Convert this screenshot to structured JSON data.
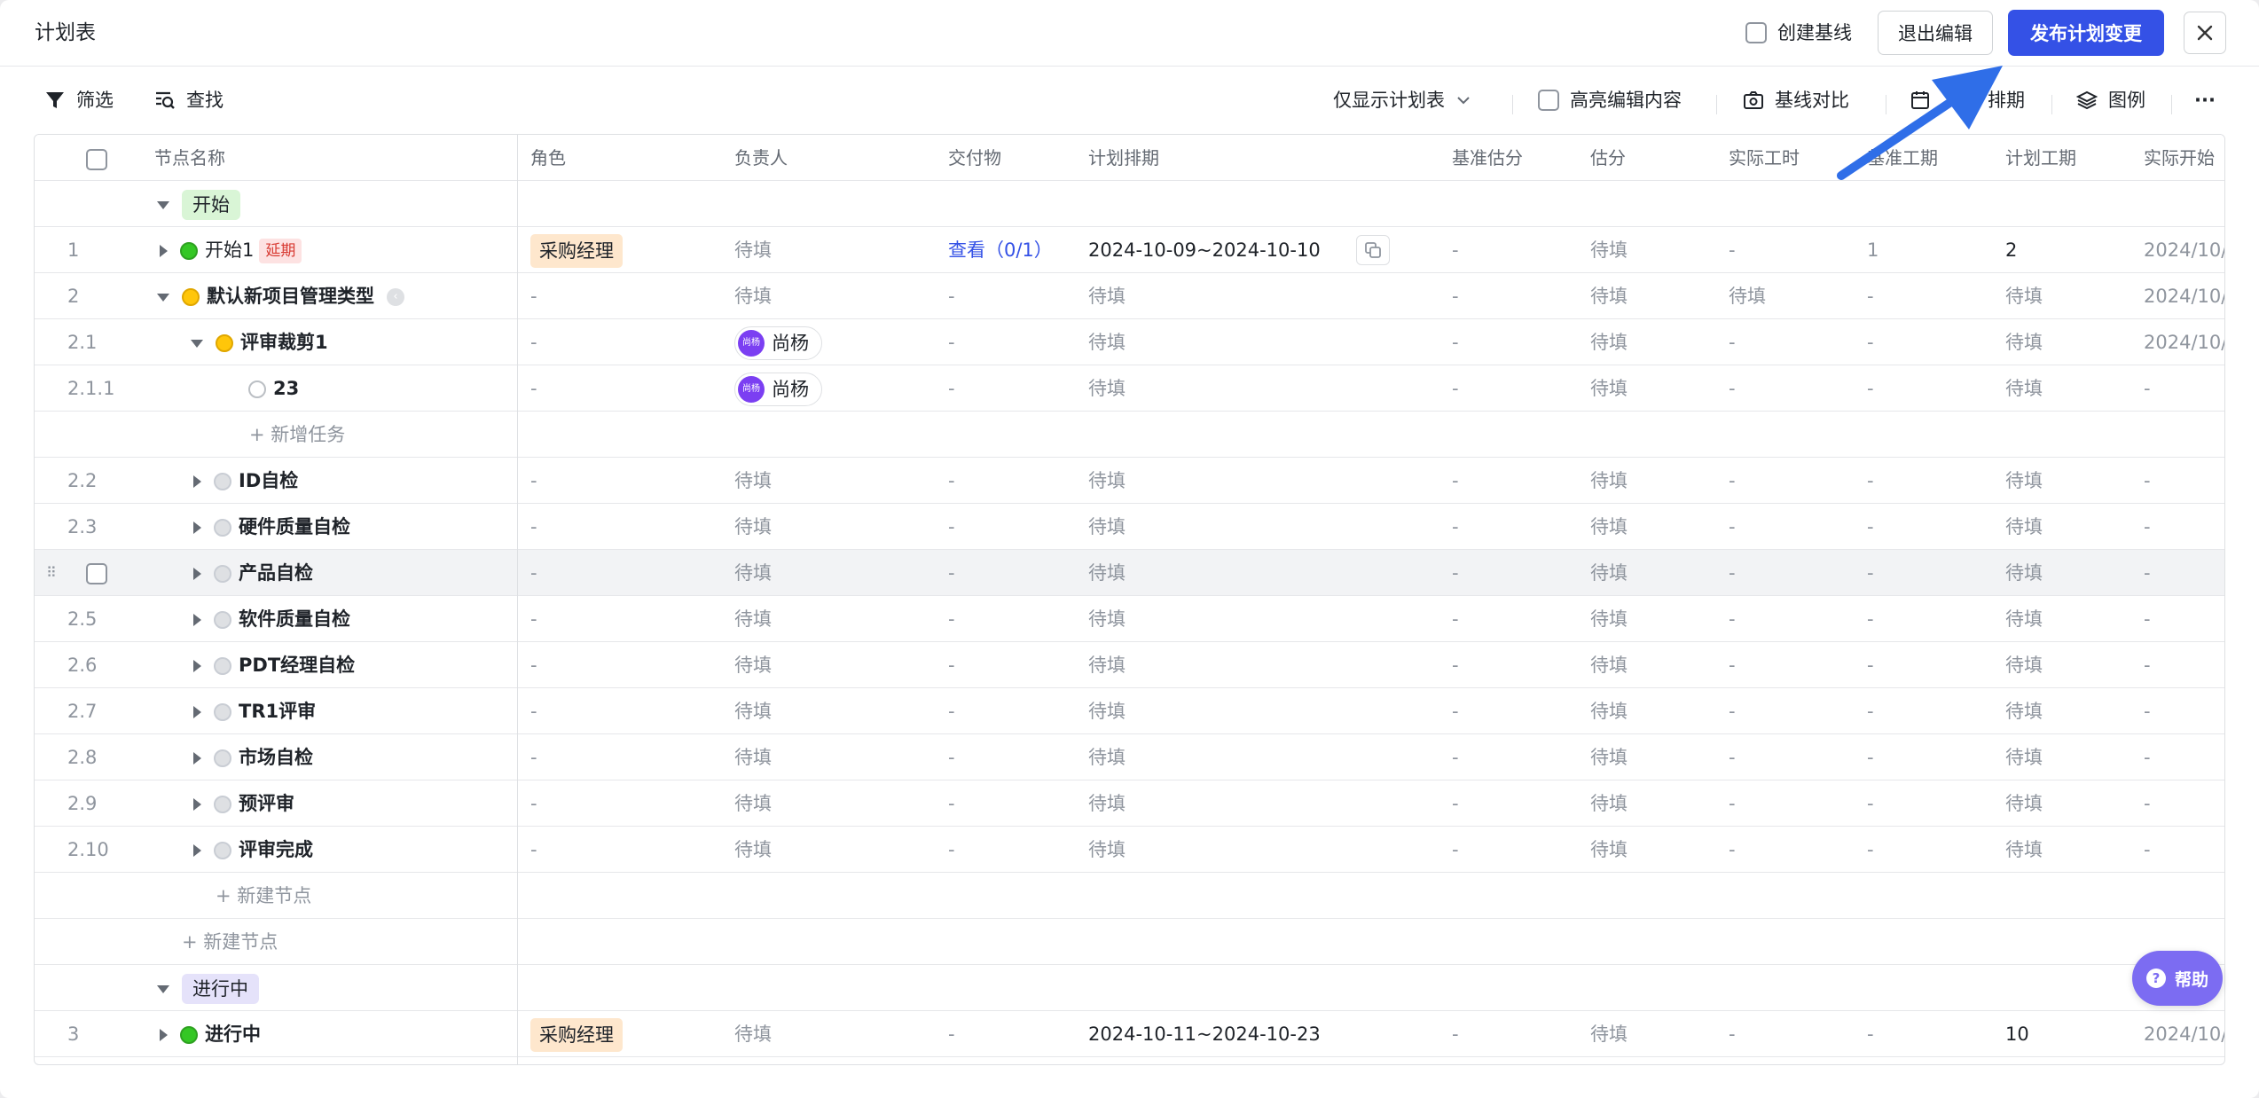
{
  "header": {
    "title": "计划表",
    "create_baseline_label": "创建基线",
    "exit_edit_label": "退出编辑",
    "publish_label": "发布计划变更"
  },
  "toolbar": {
    "filter_label": "筛选",
    "search_label": "查找",
    "view_select_label": "仅显示计划表",
    "highlight_label": "高亮编辑内容",
    "baseline_compare_label": "基线对比",
    "schedule_label": "排期",
    "legend_label": "图例",
    "more_label": "···"
  },
  "columns": {
    "name": "节点名称",
    "role": "角色",
    "owner": "负责人",
    "deliverable": "交付物",
    "plan_schedule": "计划排期",
    "baseline_estimate": "基准估分",
    "estimate": "估分",
    "actual_hours": "实际工时",
    "baseline_duration": "基准工期",
    "plan_duration": "计划工期",
    "actual_start": "实际开始"
  },
  "groups": {
    "start": "开始",
    "in_progress": "进行中"
  },
  "rows": {
    "r1": {
      "no": "1",
      "name": "开始1",
      "tag": "延期",
      "role": "采购经理",
      "owner": "待填",
      "deliverable": "查看（0/1）",
      "schedule": "2024-10-09~2024-10-10",
      "base_est": "-",
      "est": "待填",
      "actual": "-",
      "base_dur": "1",
      "plan_dur": "2",
      "start": "2024/10/"
    },
    "r2": {
      "no": "2",
      "name": "默认新项目管理类型",
      "role": "-",
      "owner": "待填",
      "deliverable": "-",
      "schedule": "待填",
      "base_est": "-",
      "est": "待填",
      "actual": "待填",
      "base_dur": "-",
      "plan_dur": "待填",
      "start": "2024/10/"
    },
    "r21": {
      "no": "2.1",
      "name": "评审裁剪1",
      "role": "-",
      "owner_name": "尚杨",
      "owner_avatar": "尚杨",
      "deliverable": "-",
      "schedule": "待填",
      "base_est": "-",
      "est": "待填",
      "actual": "-",
      "base_dur": "-",
      "plan_dur": "待填",
      "start": "2024/10/"
    },
    "r211": {
      "no": "2.1.1",
      "name": "23",
      "role": "-",
      "owner_name": "尚杨",
      "owner_avatar": "尚杨",
      "deliverable": "-",
      "schedule": "待填",
      "base_est": "-",
      "est": "待填",
      "actual": "-",
      "base_dur": "-",
      "plan_dur": "待填",
      "start": "-"
    },
    "add_task": "+ 新增任务",
    "r22": {
      "no": "2.2",
      "name": "ID自检"
    },
    "r23": {
      "no": "2.3",
      "name": "硬件质量自检"
    },
    "r24": {
      "no": "",
      "name": "产品自检"
    },
    "r25": {
      "no": "2.5",
      "name": "软件质量自检"
    },
    "r26": {
      "no": "2.6",
      "name": "PDT经理自检"
    },
    "r27": {
      "no": "2.7",
      "name": "TR1评审"
    },
    "r28": {
      "no": "2.8",
      "name": "市场自检"
    },
    "r29": {
      "no": "2.9",
      "name": "预评审"
    },
    "r210": {
      "no": "2.10",
      "name": "评审完成"
    },
    "add_node_inner": "+ 新建节点",
    "add_node_outer": "+ 新建节点",
    "r3": {
      "no": "3",
      "name": "进行中",
      "role": "采购经理",
      "owner": "待填",
      "deliverable": "-",
      "schedule": "2024-10-11~2024-10-23",
      "base_est": "-",
      "est": "待填",
      "actual": "-",
      "base_dur": "-",
      "plan_dur": "10",
      "start": "2024/10/"
    }
  },
  "placeholder": {
    "dash": "-",
    "todo": "待填"
  },
  "help_label": "帮助",
  "colors": {
    "primary": "#3451e6",
    "help": "#7c6cf2",
    "annotation_arrow": "#2f6ee8"
  }
}
